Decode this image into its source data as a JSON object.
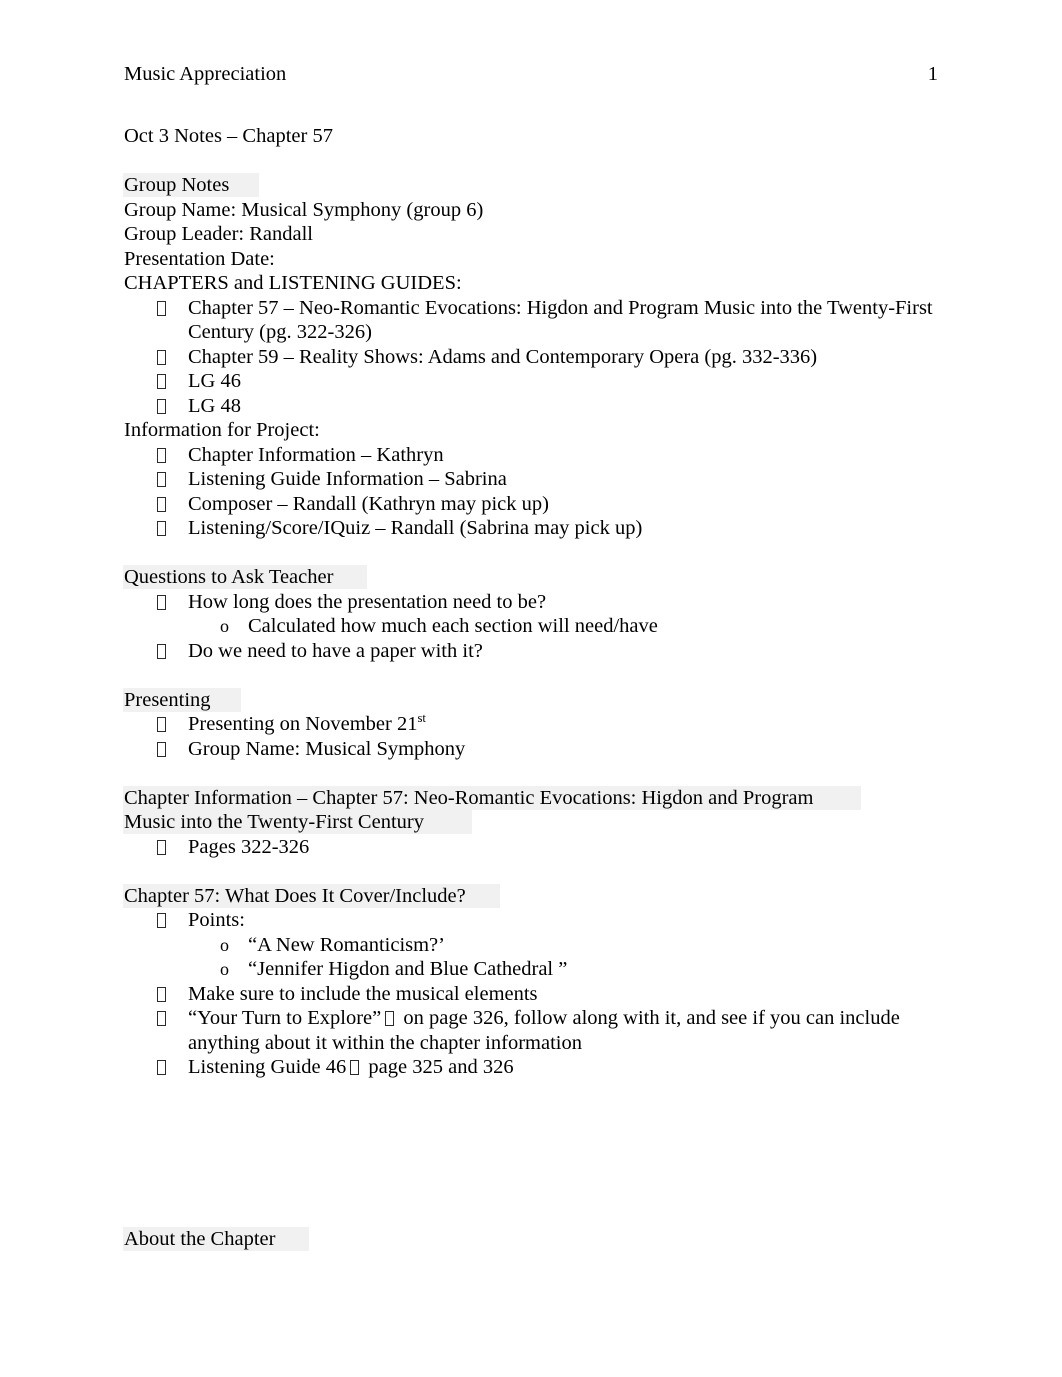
{
  "header": {
    "title": "Music Appreciation",
    "page_number": "1"
  },
  "colors": {
    "text": "#000000",
    "page_background": "#ffffff",
    "highlight": "#f1f1f1"
  },
  "icons": {
    "bullet_glyph": "missing-glyph-box",
    "sub_bullet_glyph": "o",
    "inline_arrow_glyph": "missing-glyph-box"
  },
  "document": {
    "doc_title_line": "Oct 3 Notes – Chapter 57",
    "sections": [
      {
        "heading": "Group Notes",
        "heading_highlighted": true,
        "plain_lines": [
          "Group Name: Musical Symphony (group 6)",
          "Group Leader: Randall",
          "Presentation Date:",
          "CHAPTERS and LISTENING GUIDES:"
        ],
        "bullets": [
          "Chapter 57 – Neo-Romantic Evocations: Higdon and Program Music into the Twenty-First Century (pg. 322-326)",
          "Chapter 59 – Reality Shows: Adams and Contemporary Opera (pg. 332-336)",
          "LG 46",
          "LG 48"
        ]
      },
      {
        "heading": "Information for Project:",
        "heading_highlighted": false,
        "bullets": [
          "Chapter Information – Kathryn",
          "Listening Guide Information – Sabrina",
          "Composer – Randall (Kathryn may pick up)",
          "Listening/Score/IQuiz – Randall (Sabrina may pick up)"
        ]
      },
      {
        "heading": "Questions to Ask Teacher",
        "heading_highlighted": true,
        "bullets": [
          "How long does the presentation need to be?",
          "Do we need to have a paper with it?"
        ],
        "sub_bullets": [
          "Calculated how much each section will need/have"
        ]
      },
      {
        "heading": "Presenting",
        "heading_highlighted": true,
        "bullets": [
          "Presenting on November 21st",
          "Group Name: Musical Symphony"
        ]
      }
    ],
    "chapter_info": {
      "heading_line1": "Chapter Information – Chapter 57: Neo-Romantic Evocations: Higdon and Program",
      "heading_line2": "Music into the Twenty-First Century",
      "heading_highlighted": true,
      "bullets": [
        "Pages 322-326"
      ]
    },
    "chapter_cover": {
      "heading": "Chapter 57: What Does It Cover/Include?",
      "heading_highlighted": true,
      "bullets": [
        "Points:",
        "Make sure to include the musical elements",
        "Listening Guide 46"
      ],
      "sub_bullets": [
        "“A New Romanticism?’",
        "“Jennifer Higdon and Blue Cathedral ”"
      ],
      "explore_bullet": {
        "quote": "“Your Turn to Explore”",
        "rest": "on page 326, follow along with it, and see if you can include anything about it within the chapter information"
      },
      "lg_bullet": {
        "prefix": "Listening Guide 46",
        "suffix": "page 325 and 326"
      }
    },
    "footer_section": {
      "heading": "About the Chapter",
      "heading_highlighted": true
    }
  },
  "presenting_date": {
    "prefix": "Presenting on November 21",
    "ordinal": "st"
  }
}
